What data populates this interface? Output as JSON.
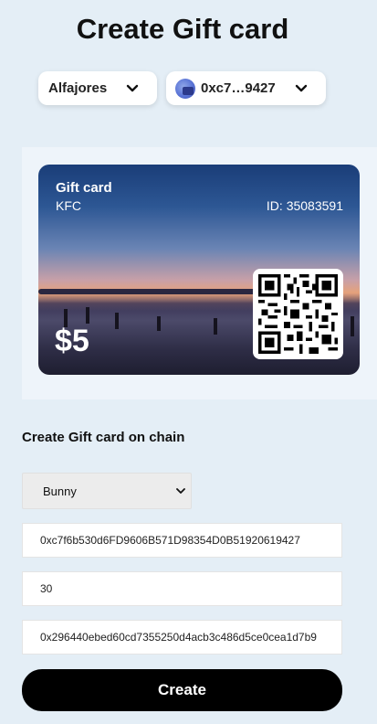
{
  "page": {
    "title": "Create Gift card"
  },
  "network_selector": {
    "label": "Alfajores",
    "icon": "chevron-down-icon"
  },
  "wallet_selector": {
    "address": "0xc7…9427",
    "icon": "chevron-down-icon"
  },
  "gift_card": {
    "label": "Gift card",
    "brand": "KFC",
    "id_text": "ID: 35083591",
    "amount": "$5"
  },
  "form": {
    "section_title": "Create Gift card on chain",
    "token_select": "Bunny",
    "recipient_address": "0xc7f6b530d6FD9606B571D98354D0B51920619427",
    "amount": "30",
    "contract_address": "0x296440ebed60cd7355250d4acb3c486d5ce0cea1d7b9"
  },
  "create_button": {
    "label": "Create"
  },
  "colors": {
    "background": "#e4eef6",
    "button": "#000000"
  }
}
